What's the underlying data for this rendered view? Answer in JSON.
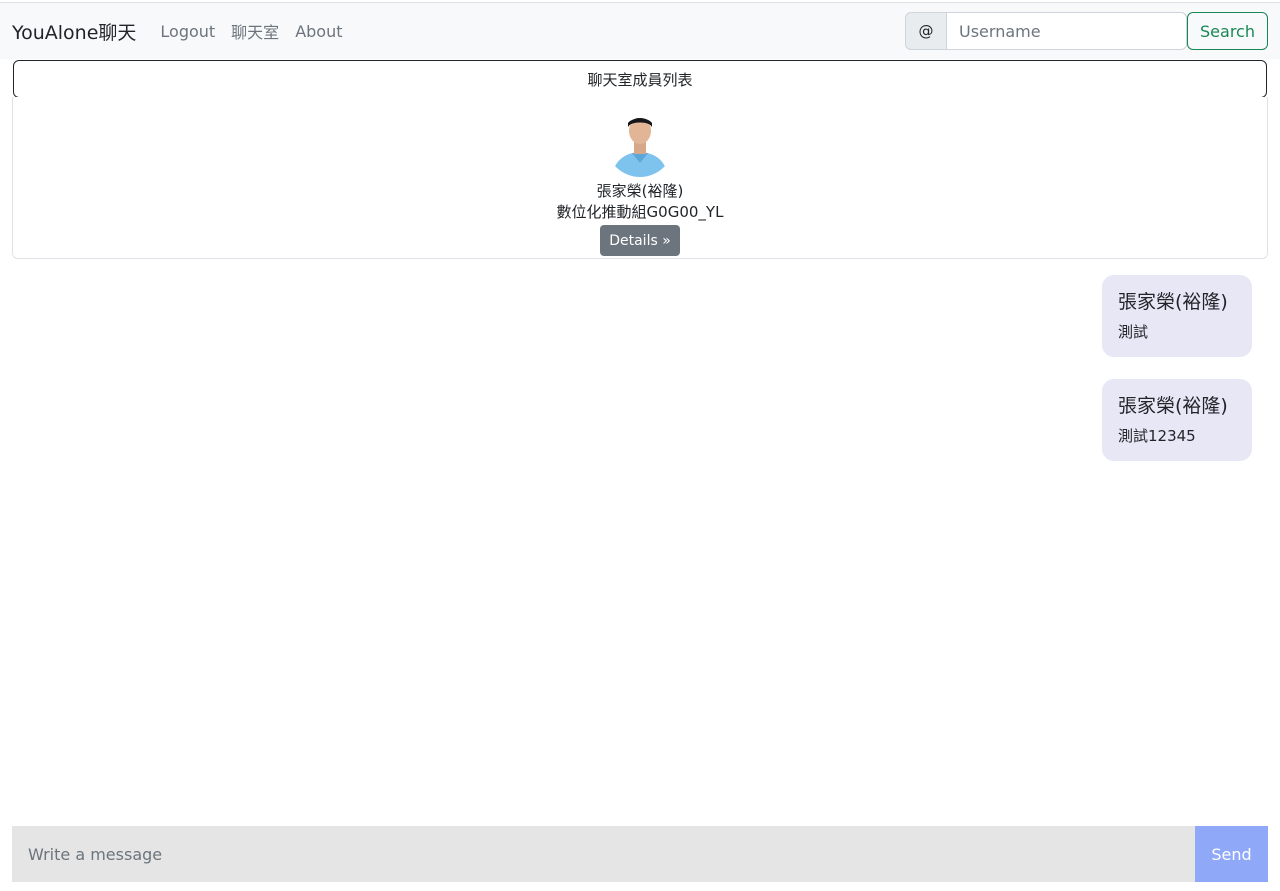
{
  "navbar": {
    "brand": "YouAlone聊天",
    "links": [
      "Logout",
      "聊天室",
      "About"
    ],
    "search": {
      "addon": "@",
      "placeholder": "Username",
      "value": "",
      "button_label": "Search"
    }
  },
  "members": {
    "toggle_label": "聊天室成員列表",
    "list": [
      {
        "name": "張家榮(裕隆)",
        "department": "數位化推動組G0G00_YL",
        "details_label": "Details »"
      }
    ]
  },
  "messages": [
    {
      "sender": "張家榮(裕隆)",
      "text": "測試"
    },
    {
      "sender": "張家榮(裕隆)",
      "text": "測試12345"
    }
  ],
  "composer": {
    "placeholder": "Write a message",
    "value": "",
    "send_label": "Send"
  },
  "colors": {
    "navbar_bg": "#f8f9fa",
    "success": "#198754",
    "secondary": "#6c757d",
    "bubble_bg": "#e8e7f6",
    "send_bg": "#8fa8f8",
    "composer_bg": "#e5e5e5"
  }
}
